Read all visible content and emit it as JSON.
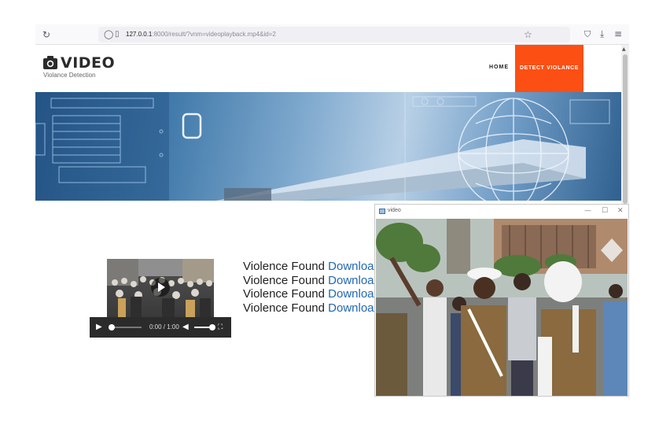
{
  "browser": {
    "url_host": "127.0.0.1",
    "url_rest": ":8000/result/?vnm=videoplayback.mp4&id=2"
  },
  "site": {
    "logo_title": "VIDEO",
    "logo_subtitle": "Violance Detection",
    "nav": [
      {
        "label": "HOME"
      },
      {
        "label": "DETECT VIOLANCE",
        "active": true
      }
    ],
    "accent_color": "#fb4f14"
  },
  "player": {
    "time_display": "0:00 / 1:00",
    "progress": 0.0,
    "volume": 1.0
  },
  "results": [
    {
      "text": "Violence Found",
      "link": "Download"
    },
    {
      "text": "Violence Found",
      "link": "Download"
    },
    {
      "text": "Violence Found",
      "link": "Download"
    },
    {
      "text": "Violence Found",
      "link": "Download"
    }
  ],
  "cv_window": {
    "title": "video",
    "buttons": [
      "—",
      "☐",
      "✕"
    ]
  },
  "icons": [
    "reload-icon",
    "shield-icon",
    "page-icon",
    "star-icon",
    "pocket-icon",
    "download-icon",
    "menu-icon",
    "camera-icon",
    "play-icon",
    "volume-icon",
    "fullscreen-icon"
  ]
}
